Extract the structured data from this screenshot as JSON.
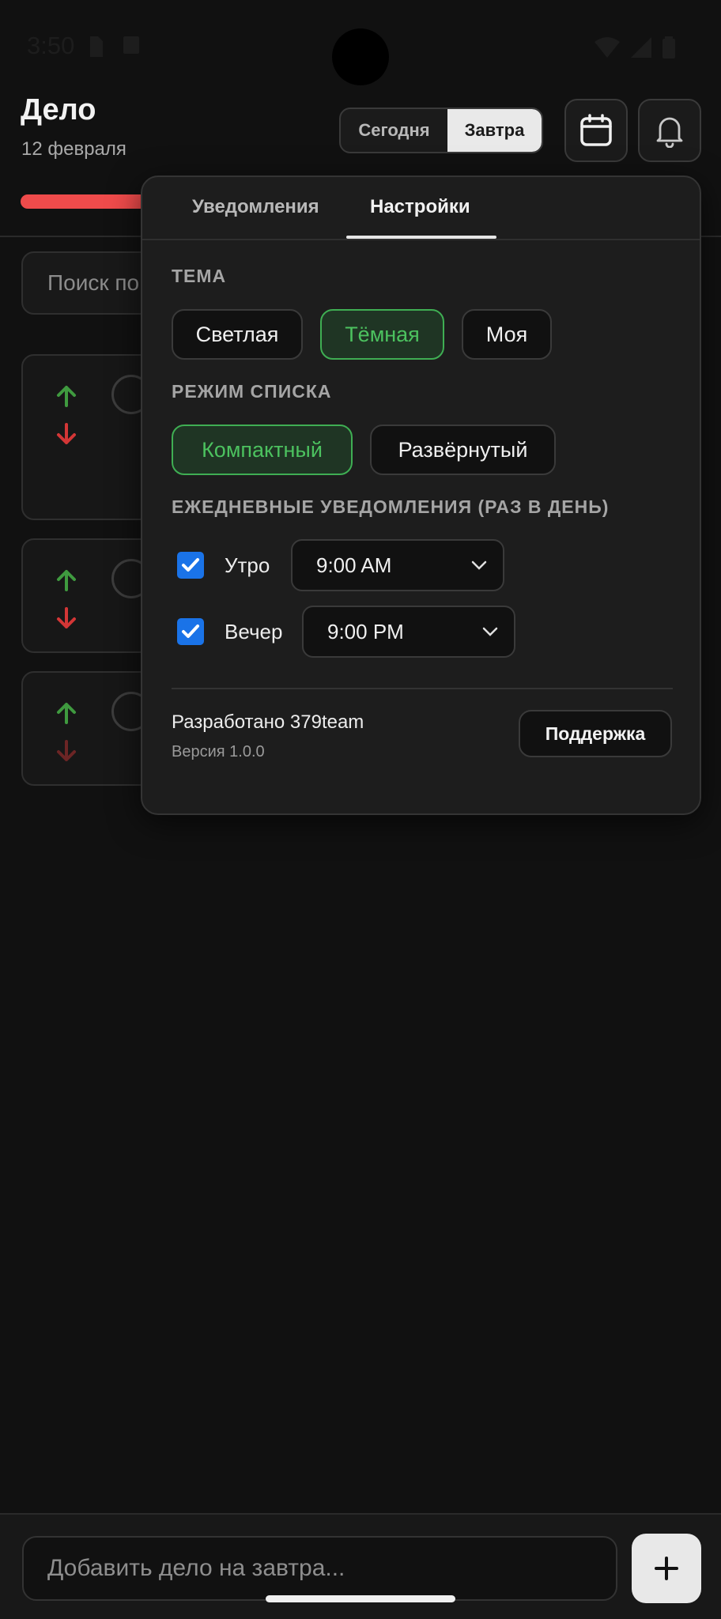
{
  "status_bar": {
    "time": "3:50"
  },
  "header": {
    "title": "Дело",
    "date": "12 февраля",
    "day_toggle": {
      "today": "Сегодня",
      "tomorrow": "Завтра",
      "selected": "tomorrow"
    },
    "progress": 0.0
  },
  "search": {
    "placeholder": "Поиск по делам"
  },
  "popover": {
    "tabs": {
      "notifications": "Уведомления",
      "settings": "Настройки",
      "active": "settings"
    },
    "theme": {
      "label": "ТЕМА",
      "options": [
        "Светлая",
        "Тёмная",
        "Моя"
      ],
      "selected": "Тёмная"
    },
    "list_mode": {
      "label": "РЕЖИМ СПИСКА",
      "options": [
        "Компактный",
        "Развёрнутый"
      ],
      "selected": "Компактный"
    },
    "daily": {
      "label": "ЕЖЕДНЕВНЫЕ УВЕДОМЛЕНИЯ (РАЗ В ДЕНЬ)",
      "morning": {
        "label": "Утро",
        "checked": true,
        "time": "9:00 AM"
      },
      "evening": {
        "label": "Вечер",
        "checked": true,
        "time": "9:00 PM"
      }
    },
    "footer": {
      "credit": "Разработано 379team",
      "version": "Версия 1.0.0",
      "support_label": "Поддержка"
    }
  },
  "add_task": {
    "placeholder": "Добавить дело на завтра...",
    "button": "+"
  },
  "colors": {
    "accent_green": "#4cc25f",
    "progress_red": "#ef4b4b",
    "checkbox_blue": "#1a73e8",
    "arrow_up": "#3f9a3f",
    "arrow_down": "#d33636"
  }
}
